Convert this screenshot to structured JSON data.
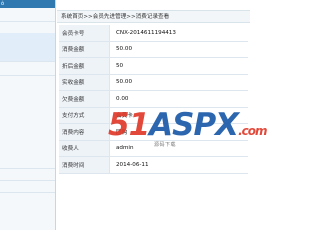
{
  "sidebar": {
    "header_label": "ô"
  },
  "breadcrumb": "系统首页>>会员先进管理>>消费记录查看",
  "record": [
    {
      "label": "会员卡号",
      "value": "CNX-2014611194413"
    },
    {
      "label": "消费金额",
      "value": "50.00"
    },
    {
      "label": "折后金额",
      "value": "50"
    },
    {
      "label": "实收金额",
      "value": "50.00"
    },
    {
      "label": "欠费金额",
      "value": "0.00"
    },
    {
      "label": "支付方式",
      "value": "会员卡"
    },
    {
      "label": "消费内容",
      "value": "团购"
    },
    {
      "label": "收费人",
      "value": "admin"
    },
    {
      "label": "消费时间",
      "value": "2014-06-11"
    }
  ],
  "watermark": {
    "text_a": "51",
    "text_b": "ASPX",
    "text_c": ".com",
    "sub": "源码下载"
  }
}
